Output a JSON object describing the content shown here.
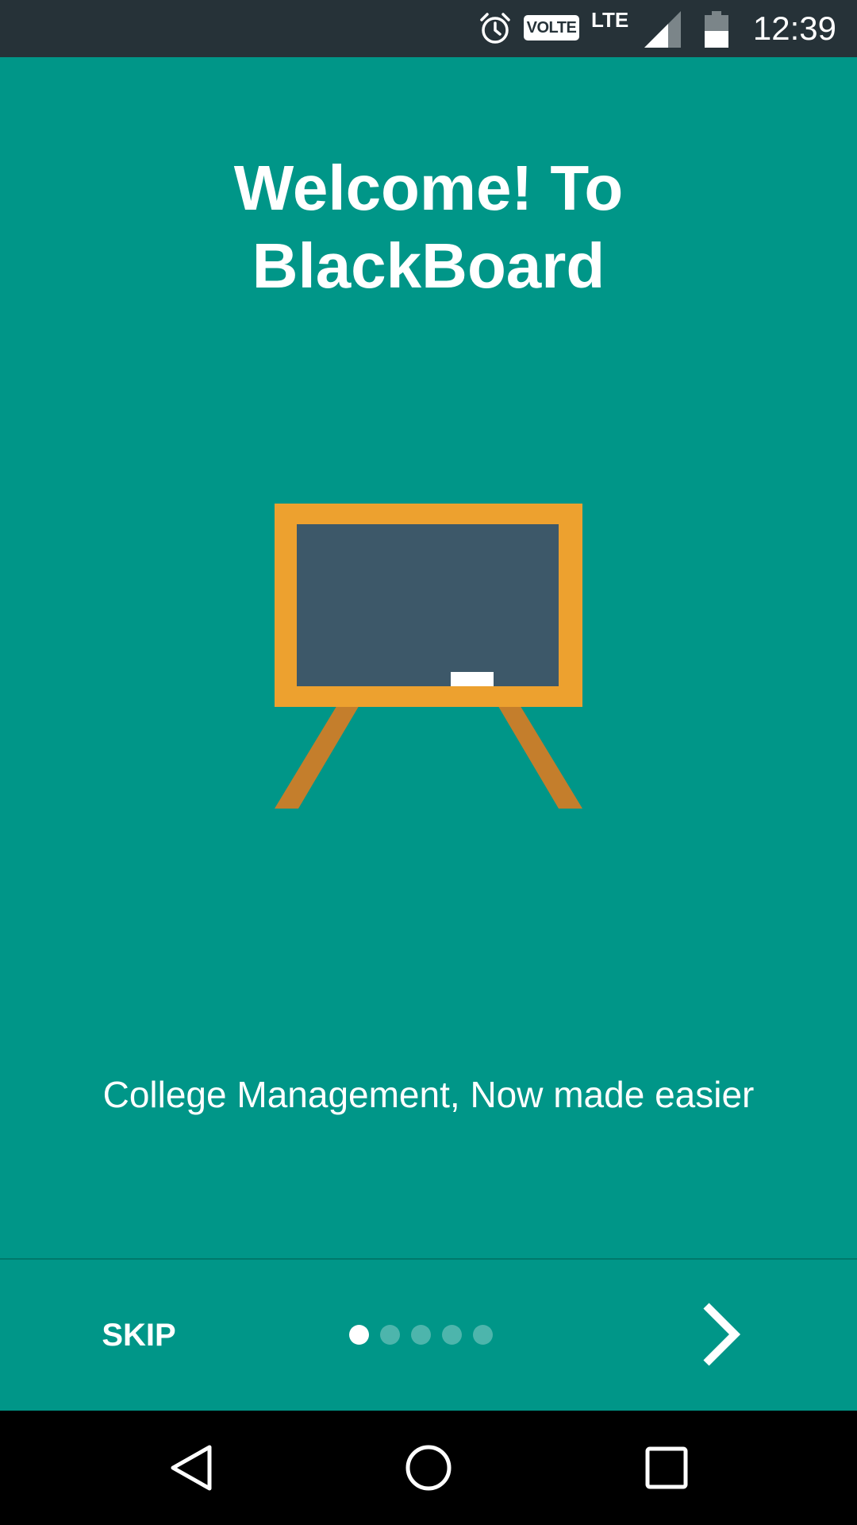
{
  "status_bar": {
    "time": "12:39",
    "volte_label": "VOLTE",
    "network_label": "LTE",
    "icons": [
      "alarm-icon",
      "volte-icon",
      "signal-icon",
      "battery-icon"
    ]
  },
  "onboarding": {
    "title_line1": "Welcome! To",
    "title_line2": "BlackBoard",
    "subtitle": "College Management, Now made easier",
    "illustration": "blackboard-easel-illustration"
  },
  "controls": {
    "skip_label": "SKIP",
    "page_count": 5,
    "current_page": 1,
    "next_icon": "chevron-right-icon"
  },
  "navigation": {
    "icons": [
      "back-icon",
      "home-icon",
      "recents-icon"
    ]
  },
  "colors": {
    "background": "#009688",
    "status_bar": "#263238",
    "board_frame": "#EDA12F",
    "board_surface": "#3D5869",
    "easel_legs": "#C47E2C",
    "chalk": "#FFFFFF"
  }
}
